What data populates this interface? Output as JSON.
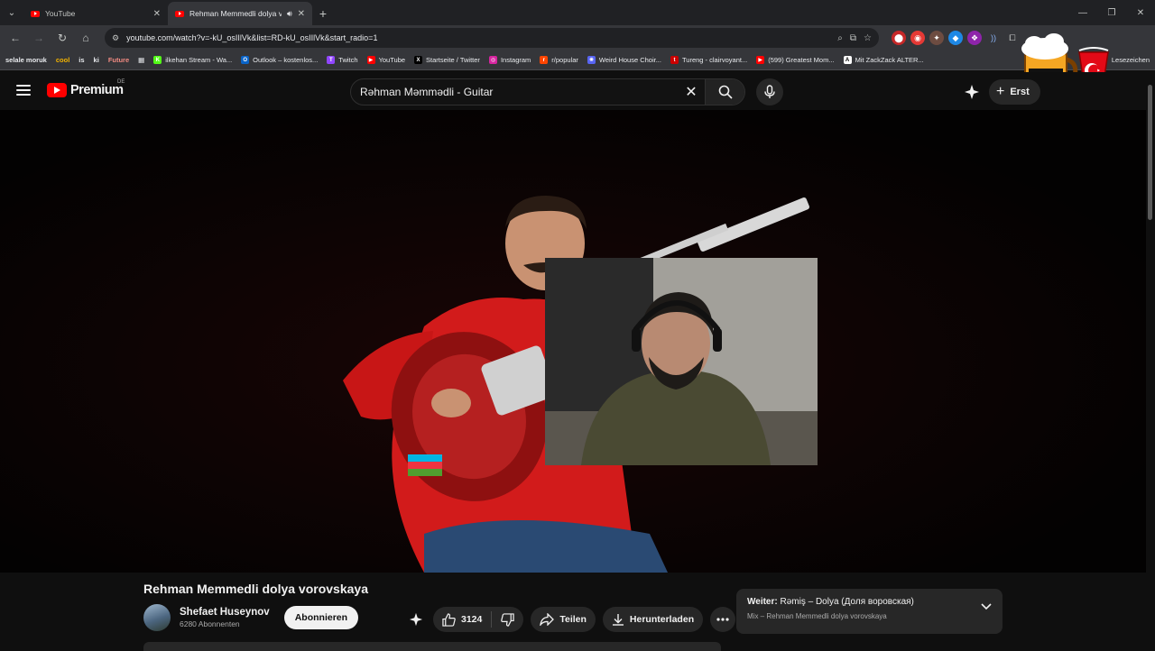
{
  "browser": {
    "tabs": [
      {
        "title": "YouTube",
        "active": false
      },
      {
        "title": "Rehman Memmedli dolya v",
        "active": true
      }
    ],
    "url": "youtube.com/watch?v=-kU_osIIlVk&list=RD-kU_osIIlVk&start_radio=1",
    "bookmarks": [
      {
        "label": "selale moruk",
        "chip": true
      },
      {
        "label": "cool",
        "chip": true,
        "color": "#f4b400"
      },
      {
        "label": "is",
        "chip": true
      },
      {
        "label": "ki",
        "chip": true
      },
      {
        "label": "Future",
        "chip": true,
        "color": "#f28b82"
      },
      {
        "label": "ilkehan Stream - Wa...",
        "icon": "K",
        "iconColor": "#53fc18"
      },
      {
        "label": "Outlook – kostenlos...",
        "icon": "O",
        "iconColor": "#0a64c8"
      },
      {
        "label": "Twitch",
        "icon": "T",
        "iconColor": "#9146ff"
      },
      {
        "label": "YouTube",
        "icon": "▶",
        "iconColor": "#ff0000"
      },
      {
        "label": "Startseite / Twitter",
        "icon": "X",
        "iconColor": "#000000"
      },
      {
        "label": "Instagram",
        "icon": "◎",
        "iconColor": "#d6249f"
      },
      {
        "label": "r/popular",
        "icon": "r",
        "iconColor": "#ff4500"
      },
      {
        "label": "Weird House Choir...",
        "icon": "✺",
        "iconColor": "#5865f2"
      },
      {
        "label": "Tureng - clairvoyant...",
        "icon": "t",
        "iconColor": "#cc0000"
      },
      {
        "label": "(599) Greatest Mom...",
        "icon": "▶",
        "iconColor": "#ff0000"
      },
      {
        "label": "Mit ZackZack ALTER...",
        "icon": "A",
        "iconColor": "#ffffff"
      }
    ],
    "bookmarks_end": "Lesezeichen"
  },
  "youtube": {
    "logo_word": "Premium",
    "region": "DE",
    "search_query": "Rəhman Məmmədli - Guitar",
    "create_label": "Erst"
  },
  "video": {
    "title": "Rehman Memmedli dolya vorovskaya",
    "channel_name": "Shefaet Huseynov",
    "subscribers": "6280 Abonnenten",
    "subscribe_label": "Abonnieren",
    "likes": "3124",
    "share_label": "Teilen",
    "download_label": "Herunterladen"
  },
  "up_next": {
    "prefix": "Weiter:",
    "title": "Rəmiş – Dolya (Доля воровская)",
    "subtitle": "Mix – Rehman Memmedli dolya vorovskaya"
  },
  "colors": {
    "brand_red": "#ff0000",
    "background": "#0f0f0f",
    "chip": "#272727"
  }
}
